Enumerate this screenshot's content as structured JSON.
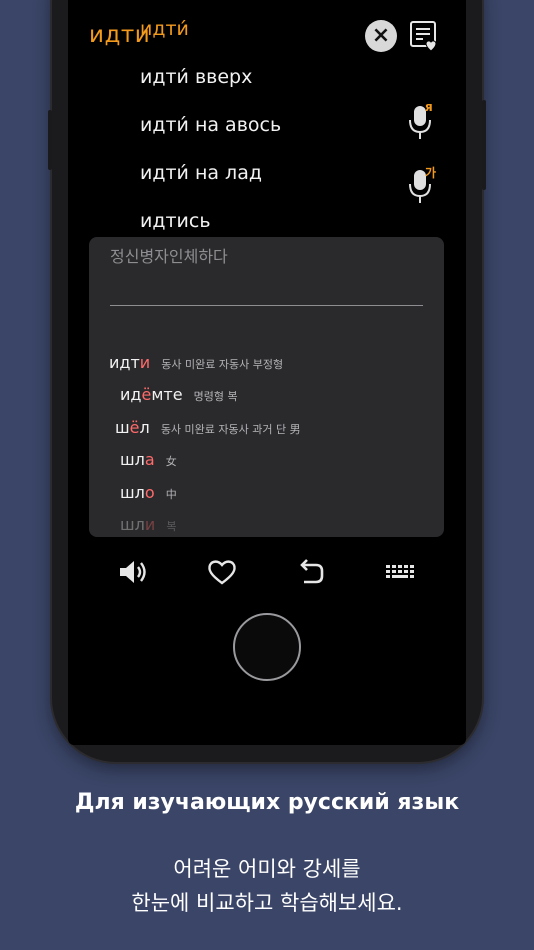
{
  "header": {
    "search_word": "идти"
  },
  "suggestions": [
    {
      "text": "идти́",
      "active": true
    },
    {
      "text": "идти́ вверх",
      "active": false
    },
    {
      "text": "идти́ на авось",
      "active": false
    },
    {
      "text": "идти́ на лад",
      "active": false
    },
    {
      "text": "идтись",
      "active": false
    }
  ],
  "mic_buttons": [
    {
      "badge": "я"
    },
    {
      "badge": "가"
    }
  ],
  "panel": {
    "input_value": "정신병자인체하다",
    "conjugations": [
      {
        "pre": "идт",
        "stress": "и",
        "post": "",
        "tag": "동사 미완료 자동사 부정형"
      },
      {
        "pre": "ид",
        "stress": "ё",
        "post": "мте",
        "tag": "명령형 복"
      },
      {
        "pre": "ш",
        "stress": "ё",
        "post": "л",
        "tag": "동사 미완료 자동사 과거 단 男"
      },
      {
        "pre": "шл",
        "stress": "а",
        "post": "",
        "tag": "女"
      },
      {
        "pre": "шл",
        "stress": "о",
        "post": "",
        "tag": "中"
      },
      {
        "pre": "шл",
        "stress": "и",
        "post": "",
        "tag": "복"
      }
    ]
  },
  "captions": {
    "headline": "Для изучающих русский язык",
    "line1": "어려운 어미와 강세를",
    "line2": "한눈에 비교하고 학습해보세요."
  },
  "colors": {
    "accent": "#f39a1d",
    "stress": "#ff6a6a",
    "background": "#3a4567"
  }
}
